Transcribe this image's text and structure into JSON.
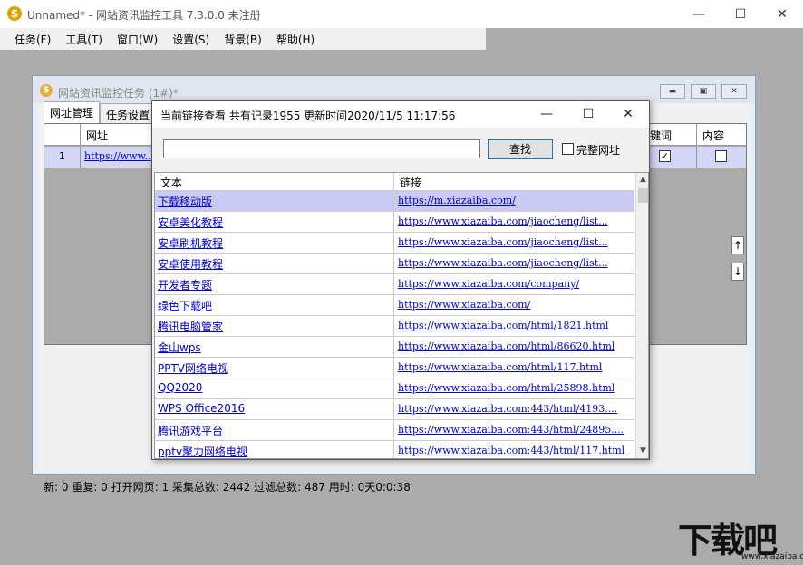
{
  "app": {
    "title": "Unnamed* - 网站资讯监控工具 7.3.0.0  未注册",
    "icon_glyph": "$",
    "minimize": "—",
    "maximize": "☐",
    "close": "✕"
  },
  "menu": [
    "任务(F)",
    "工具(T)",
    "窗口(W)",
    "设置(S)",
    "背景(B)",
    "帮助(H)"
  ],
  "child": {
    "title": "网站资讯监控任务  (1#)*",
    "icon_glyph": "$",
    "tabs": [
      "网址管理",
      "任务设置"
    ],
    "grid_headers": {
      "url": "网址",
      "keywords": "键词",
      "content": "内容"
    },
    "row": {
      "num": "1",
      "url": "https://www...",
      "keywords_checked": "✓",
      "content_checked": ""
    },
    "up_arrow": "↑",
    "down_arrow": "↓",
    "status": "新:  0   重复:  0   打开网页:  1   采集总数:  2442   过滤总数:  487   用时:  0天0:0:38"
  },
  "dialog": {
    "title": "当前链接查看   共有记录1955   更新时间2020/11/5 11:17:56",
    "search_value": "",
    "search_button": "查找",
    "full_url_label": "完整网址",
    "headers": {
      "text": "文本",
      "link": "链接"
    },
    "rows": [
      {
        "text": "下载移动版",
        "link": "https://m.xiazaiba.com/"
      },
      {
        "text": "安卓美化教程",
        "link": "https://www.xiazaiba.com/jiaocheng/list..."
      },
      {
        "text": "安卓刷机教程",
        "link": "https://www.xiazaiba.com/jiaocheng/list..."
      },
      {
        "text": "安卓使用教程",
        "link": "https://www.xiazaiba.com/jiaocheng/list..."
      },
      {
        "text": "开发者专题",
        "link": "https://www.xiazaiba.com/company/"
      },
      {
        "text": "绿色下载吧",
        "link": "https://www.xiazaiba.com/"
      },
      {
        "text": "腾讯电脑管家",
        "link": "https://www.xiazaiba.com/html/1821.html"
      },
      {
        "text": "金山wps",
        "link": "https://www.xiazaiba.com/html/86620.html"
      },
      {
        "text": "PPTV网络电视",
        "link": "https://www.xiazaiba.com/html/117.html"
      },
      {
        "text": "QQ2020",
        "link": "https://www.xiazaiba.com/html/25898.html"
      },
      {
        "text": "WPS Office2016",
        "link": "https://www.xiazaiba.com:443/html/4193...."
      },
      {
        "text": "腾讯游戏平台",
        "link": "https://www.xiazaiba.com:443/html/24895...."
      },
      {
        "text": "pptv聚力网络电视",
        "link": "https://www.xiazaiba.com:443/html/117.html"
      }
    ]
  },
  "watermark": {
    "brand": "下载吧",
    "url": "www.xiazaiba.com"
  }
}
